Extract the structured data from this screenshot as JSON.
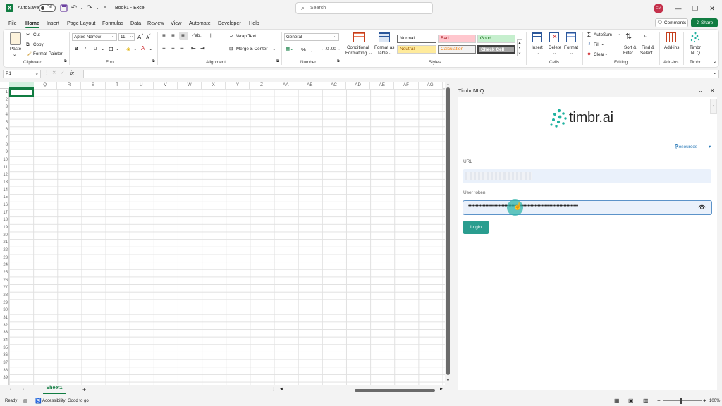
{
  "titlebar": {
    "autosave_label": "AutoSave",
    "autosave_state": "Off",
    "doc_title": "Book1  -  Excel",
    "search_placeholder": "Search",
    "avatar_initials": "EM",
    "minimize_icon": "—",
    "restore_icon": "❐",
    "close_icon": "✕"
  },
  "menu": {
    "tabs": [
      "File",
      "Home",
      "Insert",
      "Page Layout",
      "Formulas",
      "Data",
      "Review",
      "View",
      "Automate",
      "Developer",
      "Help"
    ],
    "active": "Home",
    "comments_label": "Comments",
    "share_label": "Share"
  },
  "ribbon": {
    "clipboard": {
      "paste": "Paste",
      "cut": "Cut",
      "copy": "Copy",
      "format_painter": "Format Painter",
      "label": "Clipboard"
    },
    "font": {
      "name": "Aptos Narrow",
      "size": "11",
      "bold": "B",
      "italic": "I",
      "underline": "U",
      "label": "Font"
    },
    "alignment": {
      "wrap_text": "Wrap Text",
      "merge_center": "Merge & Center",
      "label": "Alignment"
    },
    "number": {
      "format": "General",
      "label": "Number"
    },
    "styles": {
      "conditional": "Conditional",
      "conditional2": "Formatting",
      "format_as": "Format as",
      "table": "Table",
      "cells": [
        {
          "name": "Normal",
          "bg": "#ffffff",
          "fg": "#242424"
        },
        {
          "name": "Bad",
          "bg": "#ffc7ce",
          "fg": "#9c0006"
        },
        {
          "name": "Good",
          "bg": "#c6efce",
          "fg": "#006100"
        },
        {
          "name": "Neutral",
          "bg": "#ffeb9c",
          "fg": "#9c5700"
        },
        {
          "name": "Calculation",
          "bg": "#f2f2f2",
          "fg": "#fa7d00"
        },
        {
          "name": "Check Cell",
          "bg": "#a5a5a5",
          "fg": "#ffffff"
        }
      ],
      "label": "Styles"
    },
    "cells": {
      "insert": "Insert",
      "delete": "Delete",
      "format": "Format",
      "label": "Cells"
    },
    "editing": {
      "autosum": "AutoSum",
      "fill": "Fill",
      "clear": "Clear",
      "sort_filter": "Sort &",
      "sort_filter2": "Filter",
      "find_select": "Find &",
      "find_select2": "Select",
      "label": "Editing"
    },
    "addins": {
      "addins": "Add-ins",
      "label": "Add-ins"
    },
    "timbr": {
      "name": "Timbr",
      "name2": "NLQ",
      "label": "Timbr"
    }
  },
  "formula_bar": {
    "name_box": "P1",
    "fx": "fx",
    "value": ""
  },
  "grid": {
    "columns": [
      "P",
      "Q",
      "R",
      "S",
      "T",
      "U",
      "V",
      "W",
      "X",
      "Y",
      "Z",
      "AA",
      "AB",
      "AC",
      "AD",
      "AE",
      "AF",
      "AG"
    ],
    "rows": [
      "1",
      "2",
      "3",
      "4",
      "5",
      "6",
      "7",
      "8",
      "9",
      "10",
      "11",
      "12",
      "13",
      "14",
      "15",
      "16",
      "17",
      "18",
      "19",
      "20",
      "21",
      "22",
      "23",
      "24",
      "25",
      "26",
      "27",
      "28",
      "29",
      "30",
      "31",
      "32",
      "33",
      "34",
      "35",
      "36",
      "37",
      "38",
      "39"
    ],
    "sheet_tab": "Sheet1",
    "add_sheet": "+"
  },
  "status": {
    "ready": "Ready",
    "accessibility": "Accessibility: Good to go",
    "zoom": "100%"
  },
  "pane": {
    "title": "Timbr NLQ",
    "logo_text": "timbr.ai",
    "resources": "Resources",
    "url_label": "URL",
    "token_label": "User token",
    "token_value": "••••••••••••••••••••••••••••••••••••••••••••••••••••••••••••••••••••••••••••",
    "login": "Login"
  },
  "colors": {
    "accent": "#107c41",
    "timbr_teal": "#2a9d8f",
    "link": "#2a7ab8"
  }
}
